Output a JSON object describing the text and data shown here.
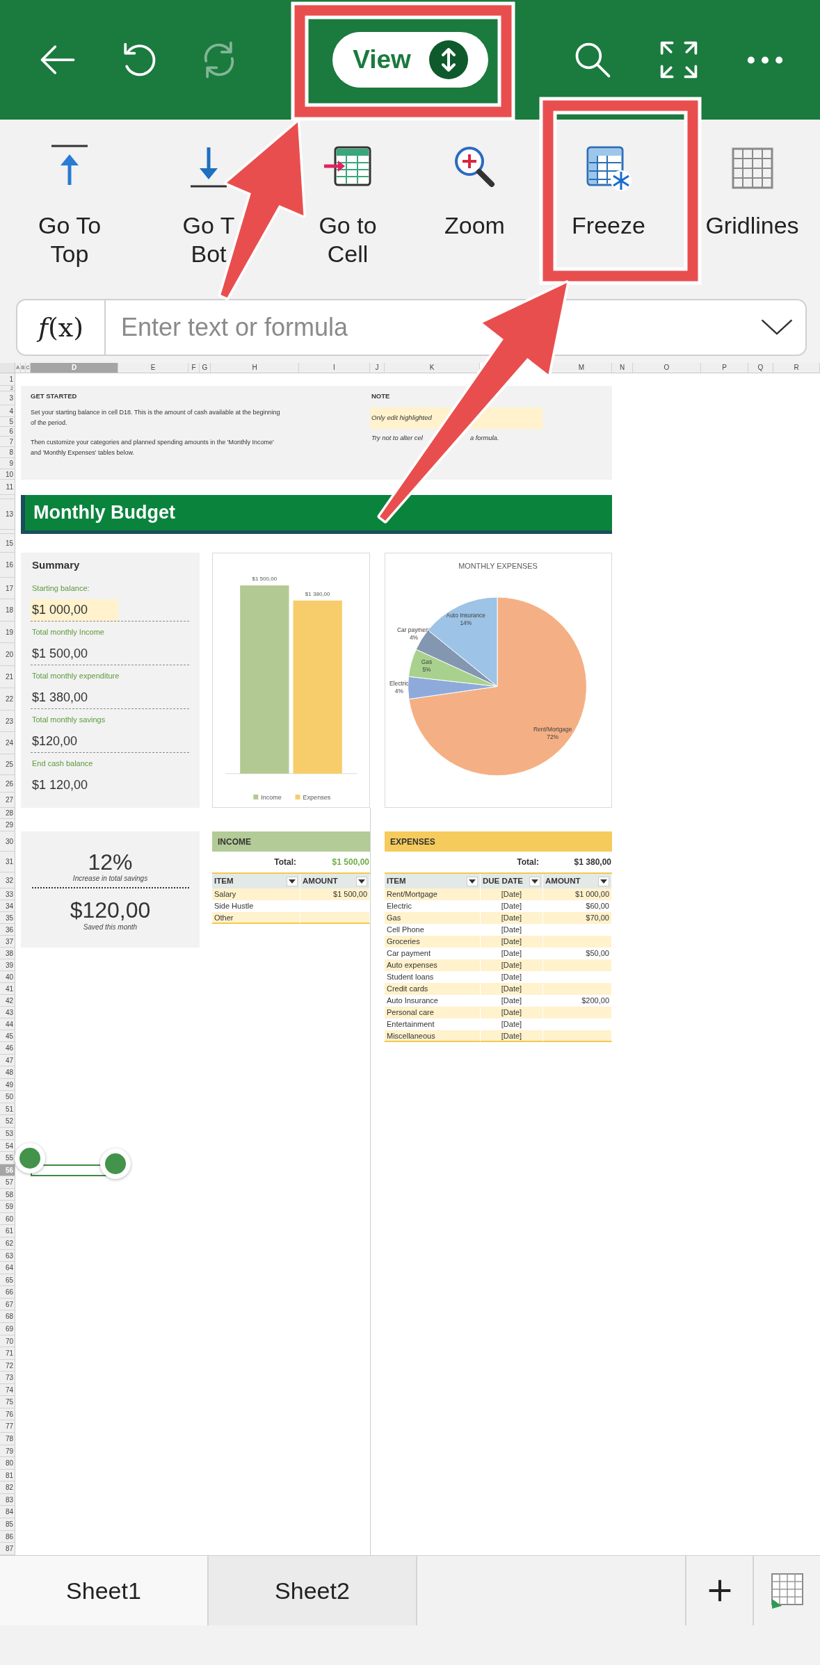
{
  "toolbar": {
    "left": [
      {
        "kind": "back",
        "disabled": false
      },
      {
        "kind": "undo",
        "disabled": false
      },
      {
        "kind": "redo",
        "disabled": true
      }
    ],
    "tab_menu": {
      "label": "View"
    },
    "right": [
      {
        "kind": "search"
      },
      {
        "kind": "fullscreen"
      },
      {
        "kind": "more"
      }
    ]
  },
  "ribbon": [
    {
      "kind": "top",
      "lines": [
        "Go To",
        "Top"
      ]
    },
    {
      "kind": "bottom",
      "lines": [
        "Go T",
        "Bot"
      ]
    },
    {
      "kind": "cell",
      "lines": [
        "Go to",
        "Cell"
      ]
    },
    {
      "kind": "zoom",
      "lines": [
        "Zoom"
      ]
    },
    {
      "kind": "freeze",
      "lines": [
        "Freeze"
      ]
    },
    {
      "kind": "gridlines",
      "lines": [
        "Gridlines"
      ]
    }
  ],
  "formula_bar": {
    "function_label": "*f*(x)",
    "placeholder": "Enter text or formula"
  },
  "sheet": {
    "columns": [
      {
        "label": "A",
        "selected": false
      },
      {
        "label": "B",
        "selected": false
      },
      {
        "label": "C",
        "selected": false
      },
      {
        "label": "D",
        "selected": true
      },
      {
        "label": "E",
        "selected": false
      },
      {
        "label": "F",
        "selected": false
      },
      {
        "label": "G",
        "selected": false
      },
      {
        "label": "H",
        "selected": false
      },
      {
        "label": "I",
        "selected": false
      },
      {
        "label": "J",
        "selected": false
      },
      {
        "label": "K",
        "selected": false
      },
      {
        "label": "M",
        "selected": false
      },
      {
        "label": "N",
        "selected": false
      },
      {
        "label": "O",
        "selected": false
      },
      {
        "label": "P",
        "selected": false
      },
      {
        "label": "Q",
        "selected": false
      },
      {
        "label": "R",
        "selected": false
      }
    ],
    "rows": [
      {
        "label": "1",
        "selected": false
      },
      {
        "label": "2",
        "selected": false
      },
      {
        "label": "3",
        "selected": false
      },
      {
        "label": "4",
        "selected": false
      },
      {
        "label": "5",
        "selected": false
      },
      {
        "label": "6",
        "selected": false
      },
      {
        "label": "7",
        "selected": false
      },
      {
        "label": "8",
        "selected": false
      },
      {
        "label": "9",
        "selected": false
      },
      {
        "label": "10",
        "selected": false
      },
      {
        "label": "11",
        "selected": false
      },
      {
        "selected": false
      },
      {
        "label": "13",
        "selected": false
      },
      {
        "selected": false
      },
      {
        "label": "15",
        "selected": false
      },
      {
        "label": "16",
        "selected": false
      },
      {
        "label": "17",
        "selected": false
      },
      {
        "label": "18",
        "selected": false
      },
      {
        "label": "19",
        "selected": false
      },
      {
        "label": "20",
        "selected": false
      },
      {
        "label": "21",
        "selected": false
      },
      {
        "label": "22",
        "selected": false
      },
      {
        "label": "23",
        "selected": false
      },
      {
        "label": "24",
        "selected": false
      },
      {
        "label": "25",
        "selected": false
      },
      {
        "label": "26",
        "selected": false
      },
      {
        "label": "27",
        "selected": false
      },
      {
        "label": "28",
        "selected": false
      },
      {
        "label": "29",
        "selected": false
      },
      {
        "label": "30",
        "selected": false
      },
      {
        "label": "31",
        "selected": false
      },
      {
        "label": "32",
        "selected": false
      },
      {
        "label": "33",
        "selected": false
      },
      {
        "label": "34",
        "selected": false
      },
      {
        "label": "35",
        "selected": false
      },
      {
        "label": "36",
        "selected": false
      },
      {
        "label": "37",
        "selected": false
      },
      {
        "label": "38",
        "selected": false
      },
      {
        "label": "39",
        "selected": false
      },
      {
        "label": "40",
        "selected": false
      },
      {
        "label": "41",
        "selected": false
      },
      {
        "label": "42",
        "selected": false
      },
      {
        "label": "43",
        "selected": false
      },
      {
        "label": "44",
        "selected": false
      },
      {
        "label": "45",
        "selected": false
      },
      {
        "label": "46",
        "selected": false
      },
      {
        "label": "47",
        "selected": false
      },
      {
        "label": "48",
        "selected": false
      },
      {
        "label": "49",
        "selected": false
      },
      {
        "label": "50",
        "selected": false
      },
      {
        "label": "51",
        "selected": false
      },
      {
        "label": "52",
        "selected": false
      },
      {
        "label": "53",
        "selected": false
      },
      {
        "label": "54",
        "selected": false
      },
      {
        "label": "55",
        "selected": false
      },
      {
        "label": "56",
        "selected": true
      },
      {
        "label": "57",
        "selected": false
      },
      {
        "label": "58",
        "selected": false
      },
      {
        "label": "59",
        "selected": false
      },
      {
        "label": "60",
        "selected": false
      },
      {
        "label": "61",
        "selected": false
      },
      {
        "label": "62",
        "selected": false
      },
      {
        "label": "63",
        "selected": false
      },
      {
        "label": "64",
        "selected": false
      },
      {
        "label": "65",
        "selected": false
      },
      {
        "label": "66",
        "selected": false
      },
      {
        "label": "67",
        "selected": false
      },
      {
        "label": "68",
        "selected": false
      },
      {
        "label": "69",
        "selected": false
      },
      {
        "label": "70",
        "selected": false
      },
      {
        "label": "71",
        "selected": false
      },
      {
        "label": "72",
        "selected": false
      },
      {
        "label": "73",
        "selected": false
      },
      {
        "label": "74",
        "selected": false
      },
      {
        "label": "75",
        "selected": false
      },
      {
        "label": "76",
        "selected": false
      },
      {
        "label": "77",
        "selected": false
      },
      {
        "label": "78",
        "selected": false
      },
      {
        "label": "79",
        "selected": false
      },
      {
        "label": "80",
        "selected": false
      },
      {
        "label": "81",
        "selected": false
      },
      {
        "label": "82",
        "selected": false
      },
      {
        "label": "83",
        "selected": false
      },
      {
        "label": "84",
        "selected": false
      },
      {
        "label": "85",
        "selected": false
      },
      {
        "label": "86",
        "selected": false
      },
      {
        "label": "87",
        "selected": false
      }
    ]
  },
  "get_started": {
    "title": "GET STARTED",
    "paragraphs": [
      "Set your starting balance in cell D18. This is the amount of cash available at the beginning of the period.",
      "Then customize your categories and planned spending amounts in the 'Monthly Income' and 'Monthly Expenses' tables below."
    ],
    "note_title": "NOTE",
    "note_highlight": "Only edit highlighted",
    "note_text_parts": [
      "Try not to alter cel",
      "a formula."
    ]
  },
  "banner": {
    "title": "Monthly Budget"
  },
  "summary": {
    "title": "Summary",
    "items": [
      {
        "label": "Starting balance:",
        "value": "$1 000,00",
        "highlighted": true
      },
      {
        "label": "Total monthly Income",
        "value": "$1 500,00",
        "highlighted": false
      },
      {
        "label": "Total monthly expenditure",
        "value": "$1 380,00",
        "highlighted": false
      },
      {
        "label": "Total monthly savings",
        "value": "$120,00",
        "highlighted": false
      },
      {
        "label": "End cash balance",
        "value": "$1 120,00",
        "highlighted": false
      }
    ]
  },
  "bar_chart": {
    "chart_data": {
      "type": "bar",
      "legend": "bottom",
      "data_labels": true,
      "series": [
        {
          "name": "Income",
          "color": "#b2c994",
          "values": [
            1500
          ],
          "value_labels": [
            "$1 500,00"
          ]
        },
        {
          "name": "Expenses",
          "color": "#f6cd6a",
          "values": [
            1380
          ],
          "value_labels": [
            "$1 380,00"
          ]
        }
      ]
    }
  },
  "pie_chart": {
    "chart_data": {
      "type": "pie",
      "title": "MONTHLY EXPENSES",
      "categories": [
        "Rent/Mortgage",
        "Electric",
        "Gas",
        "Car payment",
        "Auto Insurance"
      ],
      "values": [
        72,
        4,
        5,
        4,
        14
      ],
      "colors": [
        "#f4b084",
        "#8eaadb",
        "#a9d18e",
        "#8497b0",
        "#9dc3e6"
      ],
      "value_labels": [
        "72%",
        "4%",
        "5%",
        "4%",
        "14%"
      ]
    }
  },
  "savings": {
    "percent": "12%",
    "percent_caption": "Increase in total savings",
    "amount": "$120,00",
    "amount_caption": "Saved this month"
  },
  "income_table": {
    "title": "INCOME",
    "total_label": "Total:",
    "total": "$1 500,00",
    "columns": [
      "ITEM",
      "AMOUNT"
    ],
    "rows": [
      {
        "item": "Salary",
        "amount": "$1 500,00"
      },
      {
        "item": "Side Hustle"
      },
      {
        "item": "Other"
      }
    ]
  },
  "expenses_table": {
    "title": "EXPENSES",
    "total_label": "Total:",
    "total": "$1 380,00",
    "columns": [
      "ITEM",
      "DUE DATE",
      "AMOUNT"
    ],
    "rows": [
      {
        "item": "Rent/Mortgage",
        "due_date": "[Date]",
        "amount": "$1 000,00"
      },
      {
        "item": "Electric",
        "due_date": "[Date]",
        "amount": "$60,00"
      },
      {
        "item": "Gas",
        "due_date": "[Date]",
        "amount": "$70,00"
      },
      {
        "item": "Cell Phone",
        "due_date": "[Date]"
      },
      {
        "item": "Groceries",
        "due_date": "[Date]"
      },
      {
        "item": "Car payment",
        "due_date": "[Date]",
        "amount": "$50,00"
      },
      {
        "item": "Auto expenses",
        "due_date": "[Date]"
      },
      {
        "item": "Student loans",
        "due_date": "[Date]"
      },
      {
        "item": "Credit cards",
        "due_date": "[Date]"
      },
      {
        "item": "Auto Insurance",
        "due_date": "[Date]",
        "amount": "$200,00"
      },
      {
        "item": "Personal care",
        "due_date": "[Date]"
      },
      {
        "item": "Entertainment",
        "due_date": "[Date]"
      },
      {
        "item": "Miscellaneous",
        "due_date": "[Date]"
      }
    ]
  },
  "sheet_tabs": [
    {
      "label": "Sheet1",
      "selected": true
    },
    {
      "label": "Sheet2",
      "selected": false
    }
  ]
}
